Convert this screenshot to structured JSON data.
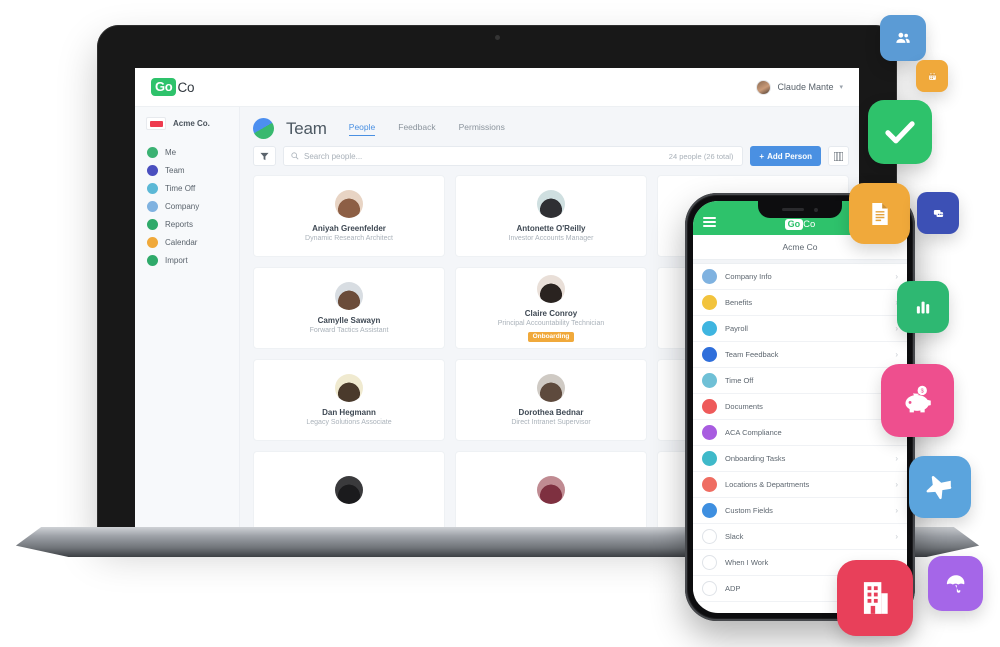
{
  "brand": {
    "logo_go": "Go",
    "logo_co": "Co",
    "green": "#2ec26b",
    "blue": "#4a90e2",
    "orange": "#f0a93b"
  },
  "webapp": {
    "topbar": {
      "user_name": "Claude Mante",
      "caret": "▾"
    },
    "sidebar": {
      "org_name": "Acme Co.",
      "items": [
        {
          "label": "Me",
          "icon": "person-icon",
          "color": "#3bb273"
        },
        {
          "label": "Team",
          "icon": "team-icon",
          "color": "#4a4fbf"
        },
        {
          "label": "Time Off",
          "icon": "beach-icon",
          "color": "#5bb8d6"
        },
        {
          "label": "Company",
          "icon": "building-icon",
          "color": "#7fb2e0"
        },
        {
          "label": "Reports",
          "icon": "reports-icon",
          "color": "#2faa6a"
        },
        {
          "label": "Calendar",
          "icon": "calendar-icon",
          "color": "#f0a93b"
        },
        {
          "label": "Import",
          "icon": "import-icon",
          "color": "#2faa6a"
        }
      ]
    },
    "page": {
      "title": "Team",
      "tabs": [
        {
          "label": "People",
          "active": true
        },
        {
          "label": "Feedback",
          "active": false
        },
        {
          "label": "Permissions",
          "active": false
        }
      ]
    },
    "toolbar": {
      "filter_icon": "filter-icon",
      "search_placeholder": "Search people...",
      "count_label": "24 people (26 total)",
      "add_person_label": "Add Person",
      "add_person_plus": "+",
      "grid_icon": "grid-view-icon"
    },
    "people": [
      {
        "name": "Aniyah Greenfelder",
        "role": "Dynamic Research Architect",
        "badge": "",
        "c1": "#8d5f45",
        "c2": "#e8d4c4"
      },
      {
        "name": "Antonette O'Reilly",
        "role": "Investor Accounts Manager",
        "badge": "",
        "c1": "#2f2f33",
        "c2": "#cfdfe0"
      },
      {
        "name": "",
        "role": "",
        "badge": "",
        "c1": "#b9c3cc",
        "c2": "#e6ebf0"
      },
      {
        "name": "Camylle Sawayn",
        "role": "Forward Tactics Assistant",
        "badge": "",
        "c1": "#6b4c3a",
        "c2": "#d8dde2"
      },
      {
        "name": "Claire Conroy",
        "role": "Principal Accountability Technician",
        "badge": "Onboarding",
        "c1": "#2a2320",
        "c2": "#e9dfd8"
      },
      {
        "name": "",
        "role": "",
        "badge": "",
        "c1": "#b9c3cc",
        "c2": "#e6ebf0"
      },
      {
        "name": "Dan Hegmann",
        "role": "Legacy Solutions Associate",
        "badge": "",
        "c1": "#4a3a2c",
        "c2": "#f0ead0"
      },
      {
        "name": "Dorothea Bednar",
        "role": "Direct Intranet Supervisor",
        "badge": "",
        "c1": "#5e4a3d",
        "c2": "#cfcac4"
      },
      {
        "name": "",
        "role": "",
        "badge": "",
        "c1": "#b9c3cc",
        "c2": "#e6ebf0"
      },
      {
        "name": "",
        "role": "",
        "badge": "",
        "c1": "#1b1b1d",
        "c2": "#3a3a3c"
      },
      {
        "name": "",
        "role": "",
        "badge": "",
        "c1": "#7e3040",
        "c2": "#c08b92"
      },
      {
        "name": "",
        "role": "",
        "badge": "",
        "c1": "#b9c3cc",
        "c2": "#e6ebf0"
      }
    ]
  },
  "phone": {
    "header_logo_go": "Go",
    "header_logo_co": "Co",
    "menu_icon": "hamburger-menu-icon",
    "org_name": "Acme Co",
    "chevron": "›",
    "items": [
      {
        "label": "Company Info",
        "icon": "building-icon",
        "color": "#7fb2e0"
      },
      {
        "label": "Benefits",
        "icon": "heart-icon",
        "color": "#f2c33d"
      },
      {
        "label": "Payroll",
        "icon": "piggy-bank-icon",
        "color": "#3fb5e0"
      },
      {
        "label": "Team Feedback",
        "icon": "chat-icon",
        "color": "#2f6fdb"
      },
      {
        "label": "Time Off",
        "icon": "beach-icon",
        "color": "#6fc0d6"
      },
      {
        "label": "Documents",
        "icon": "document-icon",
        "color": "#ee5a5a"
      },
      {
        "label": "ACA Compliance",
        "icon": "shield-icon",
        "color": "#a85ce0"
      },
      {
        "label": "Onboarding Tasks",
        "icon": "clipboard-icon",
        "color": "#3fb9c9"
      },
      {
        "label": "Locations & Departments",
        "icon": "map-pin-icon",
        "color": "#ef6d62"
      },
      {
        "label": "Custom Fields",
        "icon": "fields-icon",
        "color": "#3e8fe0"
      },
      {
        "label": "Slack",
        "icon": "slack-icon",
        "color": "#ffffff"
      },
      {
        "label": "When I Work",
        "icon": "wheniwork-icon",
        "color": "#ffffff"
      },
      {
        "label": "ADP",
        "icon": "adp-icon",
        "color": "#ffffff"
      }
    ]
  },
  "floating_tiles": [
    {
      "icon": "people-icon",
      "color": "#5b9bd5",
      "label": "People"
    },
    {
      "icon": "calendar-icon",
      "color": "#f0a93b",
      "label": "Calendar"
    },
    {
      "icon": "checkmark-icon",
      "color": "#2ec26b",
      "label": "Tasks"
    },
    {
      "icon": "document-icon",
      "color": "#f0a93b",
      "label": "Documents"
    },
    {
      "icon": "chat-icon",
      "color": "#3c50b5",
      "label": "Feedback"
    },
    {
      "icon": "bar-chart-icon",
      "color": "#2eb872",
      "label": "Reports"
    },
    {
      "icon": "piggy-bank-icon",
      "color": "#ee4f8e",
      "label": "Payroll"
    },
    {
      "icon": "airplane-icon",
      "color": "#5ba4dd",
      "label": "Time Off"
    },
    {
      "icon": "building-icon",
      "color": "#e8405a",
      "label": "Company"
    },
    {
      "icon": "umbrella-icon",
      "color": "#a濃",
      "label": "Benefits"
    }
  ]
}
